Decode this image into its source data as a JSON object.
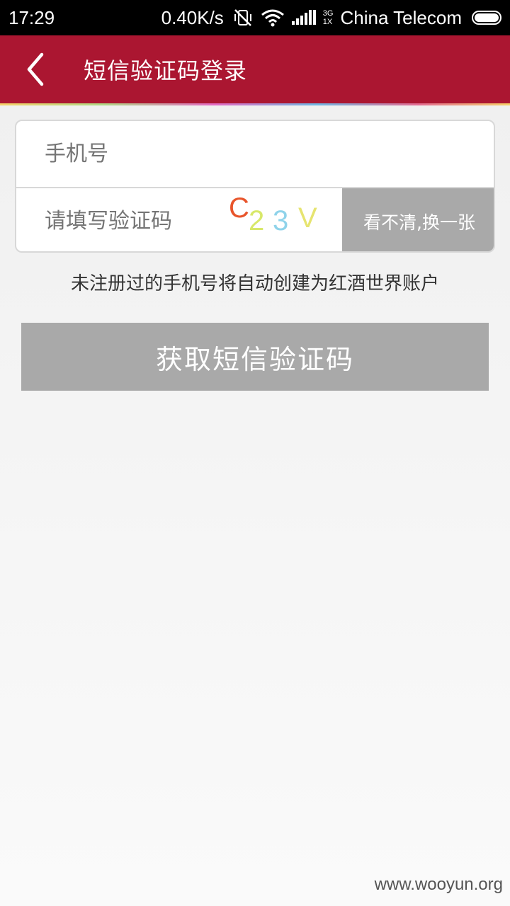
{
  "status_bar": {
    "time": "17:29",
    "net_speed": "0.40K/s",
    "network_top": "3G",
    "network_bottom": "1X",
    "carrier": "China Telecom",
    "icons": [
      "vibrate-off-icon",
      "wifi-icon",
      "signal-icon",
      "battery-icon"
    ]
  },
  "app_bar": {
    "title": "短信验证码登录",
    "back_icon": "chevron-left-icon",
    "color": "#ab1631"
  },
  "form": {
    "phone_placeholder": "手机号",
    "captcha_placeholder": "请填写验证码",
    "captcha_chars": [
      {
        "char": "C",
        "color": "#e8552b"
      },
      {
        "char": "2",
        "color": "#d8e86a"
      },
      {
        "char": "3",
        "color": "#8fd3ea"
      },
      {
        "char": "V",
        "color": "#e6e470"
      }
    ],
    "refresh_label": "看不清,换一张"
  },
  "notice": "未注册过的手机号将自动创建为红酒世界账户",
  "submit_label": "获取短信验证码",
  "watermark": "www.wooyun.org"
}
